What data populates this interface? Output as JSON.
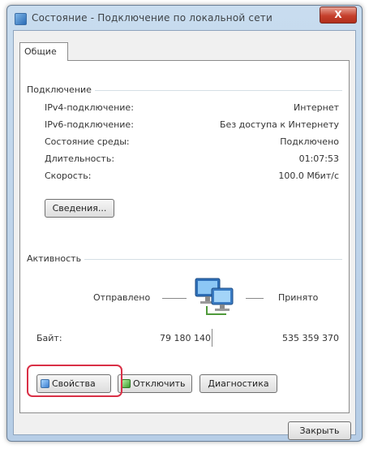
{
  "window": {
    "title": "Состояние - Подключение по локальной сети",
    "close_glyph": "X"
  },
  "tab": {
    "label": "Общие"
  },
  "connection": {
    "title": "Подключение",
    "rows": [
      {
        "label": "IPv4-подключение:",
        "value": "Интернет"
      },
      {
        "label": "IPv6-подключение:",
        "value": "Без доступа к Интернету"
      },
      {
        "label": "Состояние среды:",
        "value": "Подключено"
      },
      {
        "label": "Длительность:",
        "value": "01:07:53"
      },
      {
        "label": "Скорость:",
        "value": "100.0 Мбит/с"
      }
    ],
    "details_button": "Сведения..."
  },
  "activity": {
    "title": "Активность",
    "sent_label": "Отправлено",
    "received_label": "Принято",
    "bytes_label": "Байт:",
    "bytes_sent": "79 180 140",
    "bytes_received": "535 359 370"
  },
  "buttons": {
    "properties": "Свойства",
    "disable": "Отключить",
    "diagnose": "Диагностика",
    "close": "Закрыть"
  },
  "colors": {
    "highlight": "#d93046",
    "title_bar": "#b6cde6"
  },
  "icons": {
    "network": "network-computers-icon"
  }
}
